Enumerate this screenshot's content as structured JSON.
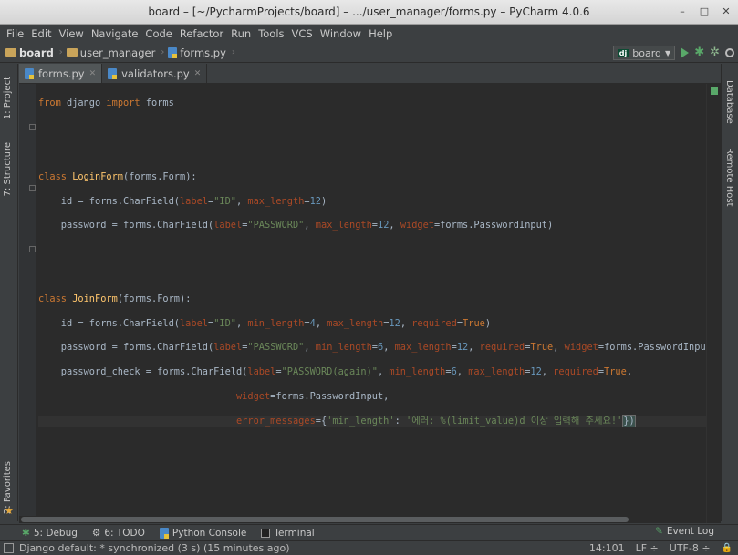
{
  "window": {
    "title": "board – [~/PycharmProjects/board] – .../user_manager/forms.py – PyCharm 4.0.6",
    "minimize_glyph": "–",
    "maximize_glyph": "□",
    "close_glyph": "✕"
  },
  "menu": [
    "File",
    "Edit",
    "View",
    "Navigate",
    "Code",
    "Refactor",
    "Run",
    "Tools",
    "VCS",
    "Window",
    "Help"
  ],
  "breadcrumb": {
    "project": "board",
    "folder": "user_manager",
    "file": "forms.py"
  },
  "run_config": {
    "badge": "dj",
    "name": "board"
  },
  "left_tools": {
    "project": "1: Project",
    "structure": "7: Structure",
    "favorites": "2: Favorites"
  },
  "right_tools": {
    "database": "Database",
    "remote_host": "Remote Host"
  },
  "tabs": [
    {
      "label": "forms.py",
      "active": true
    },
    {
      "label": "validators.py",
      "active": false
    }
  ],
  "bottom_tools": {
    "debug": "5: Debug",
    "todo": "6: TODO",
    "python_console": "Python Console",
    "terminal": "Terminal",
    "event_log": "Event Log"
  },
  "status": {
    "message": "Django default: * synchronized (3 s) (15 minutes ago)",
    "position": "14:101",
    "line_sep": "LF ÷",
    "encoding": "UTF-8 ÷"
  },
  "code": {
    "l1_kw1": "from",
    "l1_mod": " django ",
    "l1_kw2": "import",
    "l1_name": " forms",
    "l4_kw": "class",
    "l4_cls": "LoginForm",
    "l4_rest": "(forms.Form):",
    "l5_a": "    id = forms.CharField(",
    "l5_k1": "label",
    "l5_s1": "\"ID\"",
    "l5_k2": "max_length",
    "l5_n2": "12",
    "l6_a": "    password = forms.CharField(",
    "l6_k1": "label",
    "l6_s1": "\"PASSWORD\"",
    "l6_k2": "max_length",
    "l6_n2": "12",
    "l6_k3": "widget",
    "l6_v3": "forms.PasswordInput)",
    "l9_kw": "class",
    "l9_cls": "JoinForm",
    "l9_rest": "(forms.Form):",
    "l10_a": "    id = forms.CharField(",
    "l10_k1": "label",
    "l10_s1": "\"ID\"",
    "l10_k2": "min_length",
    "l10_n2": "4",
    "l10_k3": "max_length",
    "l10_n3": "12",
    "l10_k4": "required",
    "l10_b4": "True",
    "l11_a": "    password = forms.CharField(",
    "l11_k1": "label",
    "l11_s1": "\"PASSWORD\"",
    "l11_k2": "min_length",
    "l11_n2": "6",
    "l11_k3": "max_length",
    "l11_n3": "12",
    "l11_k4": "required",
    "l11_b4": "True",
    "l11_k5": "widget",
    "l11_v5": "forms.PasswordInput)",
    "l12_a": "    password_check = forms.CharField(",
    "l12_k1": "label",
    "l12_s1": "\"PASSWORD(again)\"",
    "l12_k2": "min_length",
    "l12_n2": "6",
    "l12_k3": "max_length",
    "l12_n3": "12",
    "l12_k4": "required",
    "l12_b4": "True",
    "l13_k": "widget",
    "l13_v": "forms.PasswordInput,",
    "l14_k": "error_messages",
    "l14_s1": "'min_length'",
    "l14_s2": "'에러: %(limit_value)d 이상 입력해 주세요!'",
    "l14_end": "})"
  }
}
